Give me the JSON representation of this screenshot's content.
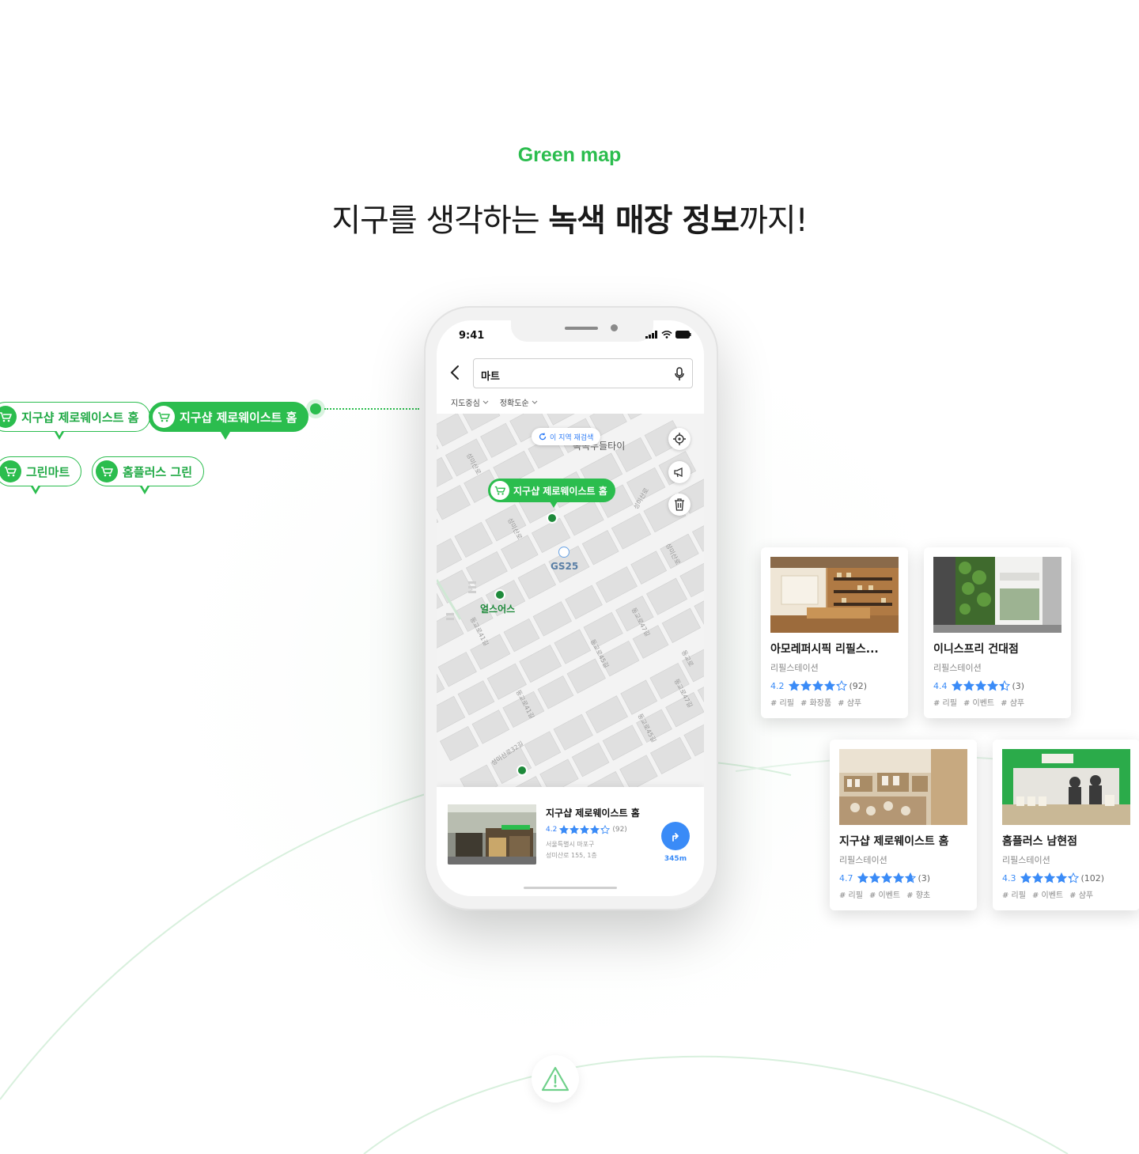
{
  "section_label": "Green map",
  "headline": {
    "part1": "지구를 생각하는 ",
    "bold1": "녹색 매장 정보",
    "part2": "까지!"
  },
  "accent_color": "#2bbd4e",
  "marker_pins": [
    {
      "label": "지구샵 제로웨이스트 홈",
      "style": "outline",
      "icon": "cart-icon"
    },
    {
      "label": "지구샵 제로웨이스트 홈",
      "style": "filled",
      "icon": "cart-icon"
    },
    {
      "label": "그린마트",
      "style": "outline",
      "icon": "cart-icon"
    },
    {
      "label": "홈플러스 그린",
      "style": "outline",
      "icon": "cart-icon"
    }
  ],
  "phone": {
    "status_time": "9:41",
    "search_value": "마트",
    "filters": [
      "지도중심",
      "정확도순"
    ],
    "map": {
      "refresh_label": "이 지역 재검색",
      "pin_label": "지구샵 제로웨이스트 홈",
      "poi": [
        "GS25",
        "얼스어스",
        "녹녹두들타이"
      ],
      "streets": [
        "성미산로",
        "동교로41길",
        "동교로45길",
        "동교로47길",
        "성미산로32길",
        "동교로"
      ]
    },
    "bottom_card": {
      "title": "지구샵 제로웨이스트 홈",
      "rating": "4.2",
      "rating_value": 4.2,
      "review_count": "(92)",
      "address_line1": "서울특별시 마포구",
      "address_line2": "성미산로 155, 1층",
      "distance": "345m"
    }
  },
  "store_cards": [
    {
      "title": "아모레퍼시픽 리필스...",
      "category": "리필스테이션",
      "rating": "4.2",
      "rating_value": 4.2,
      "reviews": "(92)",
      "tags": [
        "# 리필",
        "# 화장품",
        "# 샴푸"
      ]
    },
    {
      "title": "이니스프리 건대점",
      "category": "리필스테이션",
      "rating": "4.4",
      "rating_value": 4.4,
      "reviews": "(3)",
      "tags": [
        "# 리필",
        "# 이벤트",
        "# 샴푸"
      ]
    },
    {
      "title": "지구샵 제로웨이스트 홈",
      "category": "리필스테이션",
      "rating": "4.7",
      "rating_value": 4.7,
      "reviews": "(3)",
      "tags": [
        "# 리필",
        "# 이벤트",
        "# 향초"
      ]
    },
    {
      "title": "홈플러스 남현점",
      "category": "리필스테이션",
      "rating": "4.3",
      "rating_value": 4.3,
      "reviews": "(102)",
      "tags": [
        "# 리필",
        "# 이벤트",
        "# 샴푸"
      ]
    }
  ],
  "star_color": "#3a8bf7"
}
